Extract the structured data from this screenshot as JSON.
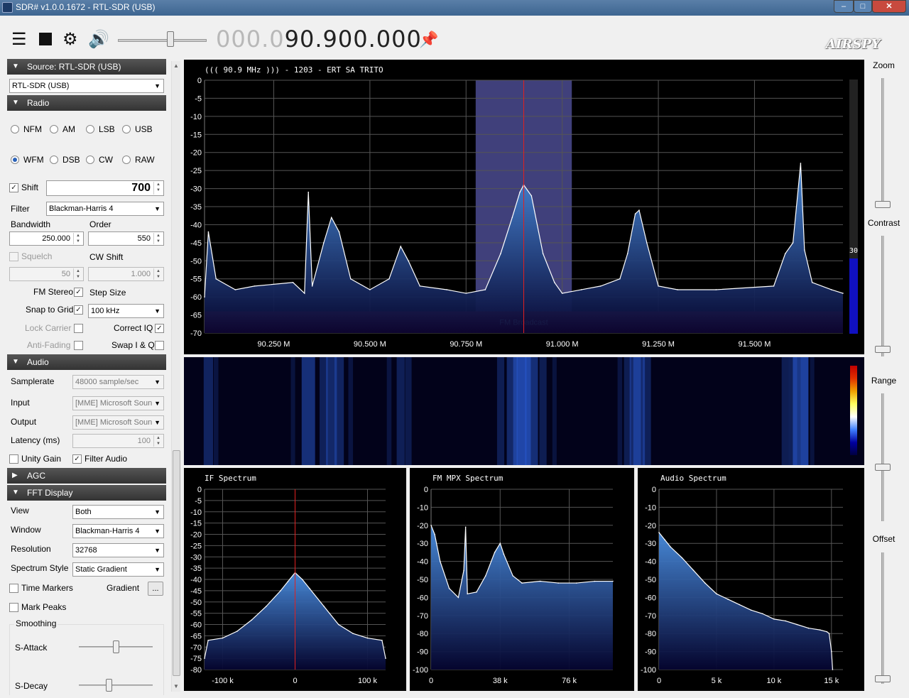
{
  "window": {
    "title": "SDR# v1.0.0.1672 - RTL-SDR (USB)"
  },
  "toolbar": {
    "frequency_dim": "000.0",
    "frequency_bright": "90.900.000",
    "logo": "AIRSPY"
  },
  "left": {
    "source": {
      "header": "Source: RTL-SDR (USB)",
      "device": "RTL-SDR (USB)"
    },
    "radio": {
      "header": "Radio",
      "modes": [
        "NFM",
        "AM",
        "LSB",
        "USB",
        "WFM",
        "DSB",
        "CW",
        "RAW"
      ],
      "selected_mode": "WFM",
      "shift_label": "Shift",
      "shift_value": "700",
      "filter_label": "Filter",
      "filter_value": "Blackman-Harris 4",
      "bandwidth_label": "Bandwidth",
      "bandwidth_value": "250.000",
      "order_label": "Order",
      "order_value": "550",
      "squelch_label": "Squelch",
      "squelch_value": "50",
      "cw_shift_label": "CW Shift",
      "cw_shift_value": "1.000",
      "fm_stereo_label": "FM Stereo",
      "step_size_label": "Step Size",
      "snap_label": "Snap to Grid",
      "step_value": "100 kHz",
      "lock_carrier_label": "Lock Carrier",
      "correct_iq_label": "Correct IQ",
      "anti_fading_label": "Anti-Fading",
      "swap_iq_label": "Swap I & Q"
    },
    "audio": {
      "header": "Audio",
      "samplerate_label": "Samplerate",
      "samplerate_value": "48000 sample/sec",
      "input_label": "Input",
      "input_value": "[MME] Microsoft Soun",
      "output_label": "Output",
      "output_value": "[MME] Microsoft Soun",
      "latency_label": "Latency (ms)",
      "latency_value": "100",
      "unity_gain_label": "Unity Gain",
      "filter_audio_label": "Filter Audio"
    },
    "agc": {
      "header": "AGC"
    },
    "fft": {
      "header": "FFT Display",
      "view_label": "View",
      "view_value": "Both",
      "window_label": "Window",
      "window_value": "Blackman-Harris 4",
      "resolution_label": "Resolution",
      "resolution_value": "32768",
      "style_label": "Spectrum Style",
      "style_value": "Static Gradient",
      "time_markers_label": "Time Markers",
      "gradient_label": "Gradient",
      "gradient_button": "...",
      "mark_peaks_label": "Mark Peaks",
      "smoothing_label": "Smoothing",
      "s_attack_label": "S-Attack",
      "s_decay_label": "S-Decay"
    }
  },
  "right": {
    "zoom_label": "Zoom",
    "contrast_label": "Contrast",
    "range_label": "Range",
    "offset_label": "Offset"
  },
  "main": {
    "station": "((( 90.9 MHz ))) - 1203 - ERT SA TRITO",
    "band_label": "FM Broadcast",
    "meter_value": "30",
    "if_title": "IF Spectrum",
    "mpx_title": "FM MPX Spectrum",
    "audio_title": "Audio Spectrum"
  },
  "colors": {
    "spectrum_fill": "#1e5ab4",
    "filter_band": "#50509a",
    "center_line": "#e02020",
    "band_plan": "#a00010",
    "section_header": "#3a3a3a"
  },
  "chart_data": [
    {
      "type": "area",
      "name": "main-spectrum",
      "x_ticks": [
        "90.250 M",
        "90.500 M",
        "90.750 M",
        "91.000 M",
        "91.250 M",
        "91.500 M"
      ],
      "x_tick_values": [
        90.25,
        90.5,
        90.75,
        91.0,
        91.25,
        91.5
      ],
      "xlim": [
        90.07,
        91.73
      ],
      "ylim": [
        -70,
        0
      ],
      "y_ticks": [
        0,
        -5,
        -10,
        -15,
        -20,
        -25,
        -30,
        -35,
        -40,
        -45,
        -50,
        -55,
        -60,
        -65,
        -70
      ],
      "filter_band": [
        90.775,
        91.025
      ],
      "center": 90.9,
      "band_plan_range": [
        -70,
        -64
      ],
      "grid": true,
      "x": [
        90.07,
        90.08,
        90.1,
        90.15,
        90.2,
        90.3,
        90.33,
        90.34,
        90.35,
        90.38,
        90.4,
        90.42,
        90.45,
        90.5,
        90.55,
        90.58,
        90.6,
        90.63,
        90.7,
        90.75,
        90.8,
        90.84,
        90.87,
        90.89,
        90.9,
        90.92,
        90.95,
        90.98,
        91.0,
        91.05,
        91.1,
        91.15,
        91.17,
        91.19,
        91.2,
        91.22,
        91.25,
        91.3,
        91.4,
        91.55,
        91.58,
        91.6,
        91.62,
        91.63,
        91.65,
        91.7,
        91.73
      ],
      "values": [
        -60,
        -42,
        -55,
        -58,
        -57,
        -56,
        -59,
        -31,
        -57,
        -45,
        -38,
        -42,
        -55,
        -58,
        -55,
        -46,
        -50,
        -57,
        -58,
        -59,
        -58,
        -48,
        -38,
        -31,
        -29,
        -32,
        -48,
        -56,
        -59,
        -58,
        -57,
        -55,
        -48,
        -37,
        -36,
        -45,
        -57,
        -58,
        -58,
        -57,
        -48,
        -45,
        -23,
        -47,
        -56,
        -58,
        -59
      ]
    },
    {
      "type": "area",
      "name": "if-spectrum",
      "x_ticks": [
        "-100 k",
        "0",
        "100 k"
      ],
      "x_tick_values": [
        -100,
        0,
        100
      ],
      "xlim": [
        -125,
        125
      ],
      "ylim": [
        -80,
        0
      ],
      "y_ticks": [
        0,
        -5,
        -10,
        -15,
        -20,
        -25,
        -30,
        -35,
        -40,
        -45,
        -50,
        -55,
        -60,
        -65,
        -70,
        -75,
        -80
      ],
      "center": 0,
      "grid": true,
      "x": [
        -125,
        -120,
        -100,
        -80,
        -60,
        -40,
        -20,
        -10,
        0,
        10,
        20,
        40,
        60,
        80,
        100,
        120,
        125
      ],
      "values": [
        -75,
        -67,
        -66,
        -63,
        -58,
        -52,
        -45,
        -41,
        -37,
        -40,
        -44,
        -52,
        -60,
        -64,
        -66,
        -67,
        -75
      ]
    },
    {
      "type": "area",
      "name": "fm-mpx-spectrum",
      "x_ticks": [
        "0",
        "38 k",
        "76 k"
      ],
      "x_tick_values": [
        0,
        38,
        76
      ],
      "xlim": [
        0,
        100
      ],
      "ylim": [
        -100,
        0
      ],
      "y_ticks": [
        0,
        -10,
        -20,
        -30,
        -40,
        -50,
        -60,
        -70,
        -80,
        -90,
        -100
      ],
      "grid": true,
      "x": [
        0,
        2,
        5,
        10,
        15,
        18,
        19,
        20,
        25,
        30,
        35,
        38,
        40,
        45,
        50,
        60,
        70,
        80,
        90,
        100
      ],
      "values": [
        -20,
        -25,
        -40,
        -55,
        -60,
        -45,
        -21,
        -58,
        -57,
        -48,
        -35,
        -30,
        -36,
        -48,
        -52,
        -51,
        -52,
        -52,
        -51,
        -51
      ]
    },
    {
      "type": "area",
      "name": "audio-spectrum",
      "x_ticks": [
        "0",
        "5 k",
        "10 k",
        "15 k"
      ],
      "x_tick_values": [
        0,
        5,
        10,
        15
      ],
      "xlim": [
        0,
        16
      ],
      "ylim": [
        -100,
        0
      ],
      "y_ticks": [
        0,
        -10,
        -20,
        -30,
        -40,
        -50,
        -60,
        -70,
        -80,
        -90,
        -100
      ],
      "grid": true,
      "x": [
        0,
        0.5,
        1,
        2,
        3,
        4,
        5,
        6,
        7,
        8,
        9,
        10,
        11,
        12,
        13,
        14,
        14.6,
        14.8,
        15.0,
        15.1
      ],
      "values": [
        -24,
        -28,
        -32,
        -38,
        -45,
        -52,
        -58,
        -61,
        -64,
        -67,
        -69,
        -72,
        -73,
        -75,
        -77,
        -78,
        -79,
        -80,
        -90,
        -100
      ]
    }
  ]
}
